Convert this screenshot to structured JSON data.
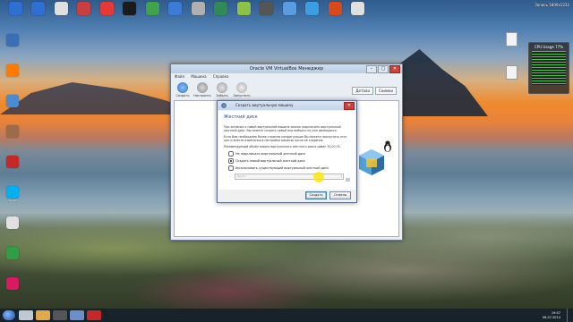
{
  "desktop": {
    "top_icons": [
      {
        "label": "",
        "color": "#2f6fd4"
      },
      {
        "label": "",
        "color": "#2f6fd4"
      },
      {
        "label": "",
        "color": "#e0e0e0"
      },
      {
        "label": "",
        "color": "#c73f3f"
      },
      {
        "label": "",
        "color": "#e53935"
      },
      {
        "label": "",
        "color": "#1b1b1b"
      },
      {
        "label": "",
        "color": "#3fa34d"
      },
      {
        "label": "",
        "color": "#3d7bd8"
      },
      {
        "label": "",
        "color": "#b0b0b0"
      },
      {
        "label": "",
        "color": "#2e8b57"
      },
      {
        "label": "",
        "color": "#8bc34a"
      },
      {
        "label": "",
        "color": "#555555"
      },
      {
        "label": "",
        "color": "#5a9ce0"
      },
      {
        "label": "",
        "color": "#3a9ee0"
      },
      {
        "label": "",
        "color": "#d84a1b"
      },
      {
        "label": "",
        "color": "#e0e0e0"
      }
    ],
    "left_icons": [
      {
        "label": "",
        "color": "#3a6fb7"
      },
      {
        "label": "",
        "color": "#ff7a00"
      },
      {
        "label": "",
        "color": "#4a8bd1"
      },
      {
        "label": "",
        "color": "#9b6b4a"
      },
      {
        "label": "",
        "color": "#c62828"
      },
      {
        "label": "Skype",
        "color": "#00aff0"
      },
      {
        "label": "",
        "color": "#e0e0e0"
      },
      {
        "label": "",
        "color": "#2f9e44"
      },
      {
        "label": "",
        "color": "#d81b60"
      }
    ],
    "right_files": [
      {
        "label": ""
      },
      {
        "label": ""
      }
    ],
    "clock_top": "Запись 1800x1232",
    "cpu_widget": {
      "title": "CPU Usage 77%"
    }
  },
  "vbox": {
    "title": "Oracle VM VirtualBox Менеджер",
    "menu": [
      "Файл",
      "Машина",
      "Справка"
    ],
    "toolbar": [
      "Создать",
      "Настроить",
      "Забыть",
      "Запустить"
    ],
    "right_tabs": [
      "Детали",
      "Снимки"
    ]
  },
  "dialog": {
    "title": "Создать виртуальную машину",
    "heading": "Жесткий диск",
    "para1": "При желании к новой виртуальной машине можно подключить виртуальный жесткий диск. Вы можете создать новый или выбрать из уже имеющихся.",
    "para2": "Если Вам необходима более сложная конфигурация Вы можете пропустить этот шаг и внести изменения в настройки машины после её создания.",
    "para3": "Рекомендуемый объём нового виртуального жесткого диска равен 32,00 ГБ.",
    "options": [
      {
        "label": "Не подключать виртуальный жесткий диск",
        "selected": false
      },
      {
        "label": "Создать новый виртуальный жесткий диск",
        "selected": true
      },
      {
        "label": "Использовать существующий виртуальный жесткий диск",
        "selected": false
      }
    ],
    "combo_placeholder": "Пусто",
    "buttons": {
      "create": "Создать",
      "cancel": "Отмена"
    }
  },
  "taskbar": {
    "time": "19:57",
    "date": "06.07.2014"
  }
}
